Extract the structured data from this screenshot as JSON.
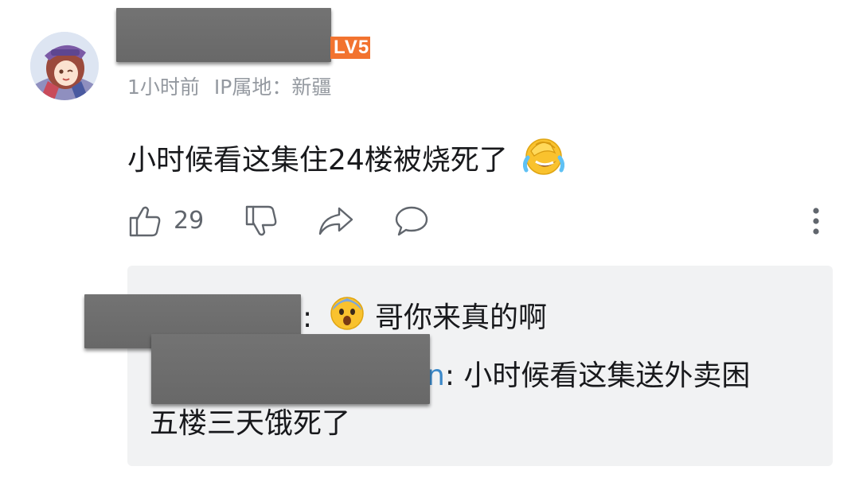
{
  "comment": {
    "level_badge": "LV5",
    "time": "1小时前",
    "ip_location": "IP属地：新疆",
    "text": "小时候看这集住24楼被烧死了",
    "emoji": "crying-laughing-emoji",
    "like_count": "29"
  },
  "replies": [
    {
      "separator": ":",
      "emoji": "fearful-face-emoji",
      "text": "哥你来真的啊"
    },
    {
      "link_fragment": "n",
      "text_line1": ": 小时候看这集送外卖困",
      "text_line2": "五楼三天饿死了"
    }
  ],
  "colors": {
    "badge": "#f2732f",
    "meta": "#9499a0",
    "reply_bg": "#f1f2f3",
    "link": "#3c89c9",
    "icon": "#61666d"
  }
}
